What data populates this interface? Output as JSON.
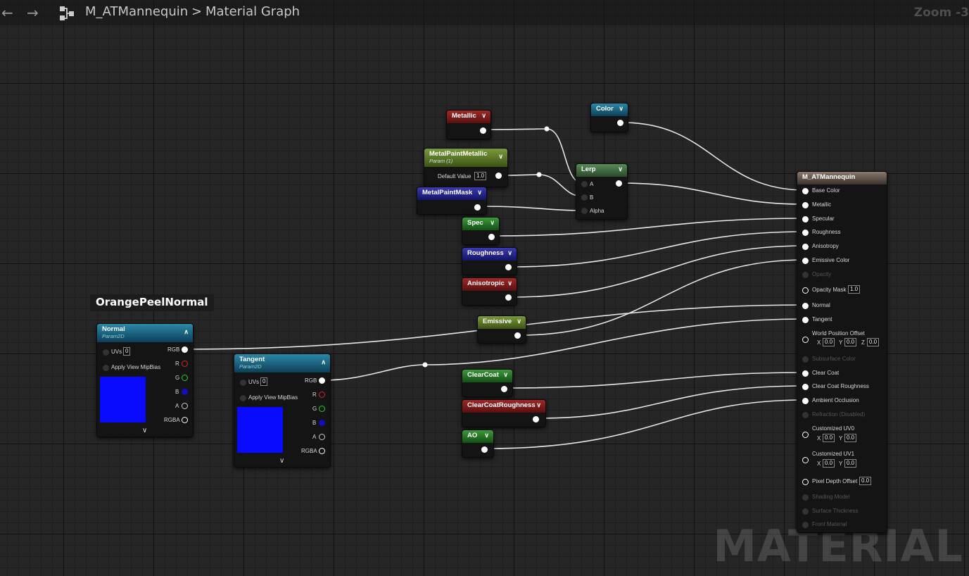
{
  "topbar": {
    "back_icon": "arrow-left-icon",
    "forward_icon": "arrow-right-icon",
    "graph_icon": "graph-icon",
    "asset_name": "M_ATMannequin",
    "separator": ">",
    "graph_name": "Material Graph",
    "zoom": "Zoom -3"
  },
  "watermark": "MATERIAL",
  "comment": "OrangePeelNormal",
  "nodes": {
    "metallic": {
      "title": "Metallic"
    },
    "color": {
      "title": "Color"
    },
    "metal_paint_metallic": {
      "title": "MetalPaintMetallic",
      "subtitle": "Param (1)",
      "default_label": "Default Value",
      "default_value": "1.0"
    },
    "lerp": {
      "title": "Lerp",
      "pin_a": "A",
      "pin_b": "B",
      "pin_alpha": "Alpha"
    },
    "metal_paint_mask": {
      "title": "MetalPaintMask"
    },
    "spec": {
      "title": "Spec"
    },
    "roughness": {
      "title": "Roughness"
    },
    "anisotropic": {
      "title": "Anisotropic"
    },
    "emissive": {
      "title": "Emissive"
    },
    "clearcoat": {
      "title": "ClearCoat"
    },
    "clearcoat_roughness": {
      "title": "ClearCoatRoughness"
    },
    "ao": {
      "title": "AO"
    },
    "normal": {
      "title": "Normal",
      "subtitle": "Param2D",
      "uvs_label": "UVs",
      "uvs_value": "0",
      "mip_label": "Apply View MipBias",
      "out_rgb": "RGB",
      "out_r": "R",
      "out_g": "G",
      "out_b": "B",
      "out_a": "A",
      "out_rgba": "RGBA"
    },
    "tangent": {
      "title": "Tangent",
      "subtitle": "Param2D",
      "uvs_label": "UVs",
      "uvs_value": "0",
      "mip_label": "Apply View MipBias",
      "out_rgb": "RGB",
      "out_r": "R",
      "out_g": "G",
      "out_b": "B",
      "out_a": "A",
      "out_rgba": "RGBA"
    },
    "main": {
      "title": "M_ATMannequin",
      "pins": {
        "base_color": "Base Color",
        "metallic": "Metallic",
        "specular": "Specular",
        "roughness": "Roughness",
        "anisotropy": "Anisotropy",
        "emissive_color": "Emissive Color",
        "opacity": "Opacity",
        "opacity_mask": "Opacity Mask",
        "opacity_mask_value": "1.0",
        "normal": "Normal",
        "tangent": "Tangent",
        "wpo": "World Position Offset",
        "wpo_x_label": "X",
        "wpo_x": "0.0",
        "wpo_y_label": "Y",
        "wpo_y": "0.0",
        "wpo_z_label": "Z",
        "wpo_z": "0.0",
        "subsurface": "Subsurface Color",
        "clear_coat": "Clear Coat",
        "clear_coat_roughness": "Clear Coat Roughness",
        "ambient_occlusion": "Ambient Occlusion",
        "refraction": "Refraction (Disabled)",
        "uv0": "Customized UV0",
        "uv0_x_label": "X",
        "uv0_x": "0.0",
        "uv0_y_label": "Y",
        "uv0_y": "0.0",
        "uv1": "Customized UV1",
        "uv1_x_label": "X",
        "uv1_x": "0.0",
        "uv1_y_label": "Y",
        "uv1_y": "0.0",
        "pixel_depth": "Pixel Depth Offset",
        "pixel_depth_value": "0.0",
        "shading_model": "Shading Model",
        "surface_thickness": "Surface Thickness",
        "front_material": "Front Material"
      }
    }
  },
  "colors": {
    "metallic": "#a02828",
    "color": "#2a8aa8",
    "metal_paint_metallic": "#6a9a3a",
    "metal_paint_mask": "#2a2aa0",
    "spec": "#2a8a2a",
    "roughness": "#2a2aa0",
    "anisotropic": "#a02828",
    "emissive": "#7a9a3a",
    "clearcoat": "#2a8a2a",
    "clearcoat_roughness": "#a02828",
    "ao": "#2a8a2a",
    "preview": "#0a0aff"
  }
}
